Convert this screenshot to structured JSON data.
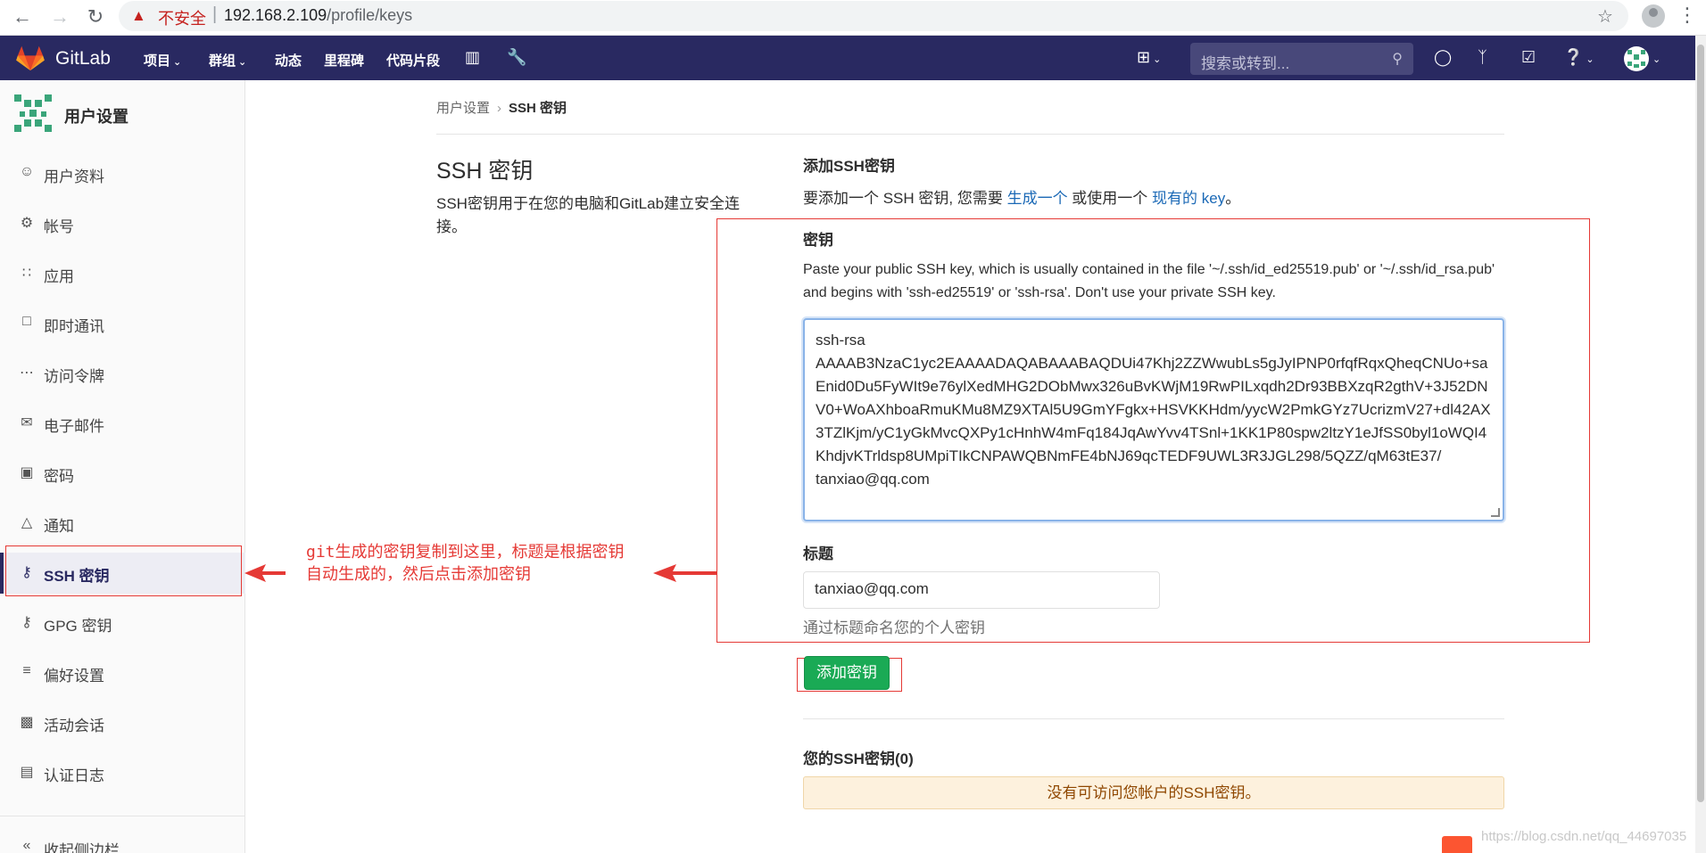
{
  "browser": {
    "insecure_label": "不安全",
    "url_host": "192.168.2.109",
    "url_path": "/profile/keys"
  },
  "header": {
    "brand": "GitLab",
    "nav": [
      {
        "label": "项目",
        "has_caret": true
      },
      {
        "label": "群组",
        "has_caret": true
      },
      {
        "label": "动态",
        "has_caret": false
      },
      {
        "label": "里程碑",
        "has_caret": false
      },
      {
        "label": "代码片段",
        "has_caret": false
      }
    ],
    "search_placeholder": "搜索或转到..."
  },
  "sidebar": {
    "title": "用户设置",
    "items": [
      {
        "label": "用户资料",
        "icon": "user-icon"
      },
      {
        "label": "帐号",
        "icon": "account-icon"
      },
      {
        "label": "应用",
        "icon": "applications-icon"
      },
      {
        "label": "即时通讯",
        "icon": "chat-icon"
      },
      {
        "label": "访问令牌",
        "icon": "token-icon"
      },
      {
        "label": "电子邮件",
        "icon": "mail-icon"
      },
      {
        "label": "密码",
        "icon": "lock-icon"
      },
      {
        "label": "通知",
        "icon": "bell-icon"
      },
      {
        "label": "SSH 密钥",
        "icon": "key-icon",
        "active": true
      },
      {
        "label": "GPG 密钥",
        "icon": "key-icon"
      },
      {
        "label": "偏好设置",
        "icon": "sliders-icon"
      },
      {
        "label": "活动会话",
        "icon": "monitor-icon"
      },
      {
        "label": "认证日志",
        "icon": "log-icon"
      }
    ],
    "collapse_label": "收起侧边栏"
  },
  "annotation": {
    "text_line1": "git生成的密钥复制到这里，标题是根据密钥",
    "text_line2": "自动生成的，然后点击添加密钥",
    "color": "#e53935"
  },
  "breadcrumb": {
    "parent": "用户设置",
    "current": "SSH 密钥"
  },
  "section": {
    "title": "SSH 密钥",
    "description": "SSH密钥用于在您的电脑和GitLab建立安全连接。"
  },
  "add_form": {
    "heading": "添加SSH密钥",
    "desc_prefix": "要添加一个 SSH 密钥, 您需要 ",
    "desc_link1": "生成一个",
    "desc_middle": " 或使用一个 ",
    "desc_link2": "现有的 key",
    "desc_suffix": "。",
    "key_label": "密钥",
    "key_help": "Paste your public SSH key, which is usually contained in the file '~/.ssh/id_ed25519.pub' or '~/.ssh/id_rsa.pub' and begins with 'ssh-ed25519' or 'ssh-rsa'. Don't use your private SSH key.",
    "key_value": "ssh-rsa\nAAAAB3NzaC1yc2EAAAADAQABAAABAQDUi47Khj2ZZWwubLs5gJyIPNP0rfqfRqxQheqCNUo+saEnid0Du5FyWIt9e76ylXedMHG2DObMwx326uBvKWjM19RwPILxqdh2Dr93BBXzqR2gthV+3J52DNV0+WoAXhboaRmuKMu8MZ9XTAl5U9GmYFgkx+HSVKKHdm/yycW2PmkGYz7UcrizmV27+dl42AX3TZlKjm/yC1yGkMvcQXPy1cHnhW4mFq184JqAwYvv4TSnl+1KK1P80spw2ltzY1eJfSS0byl1oWQI4KhdjvKTrldsp8UMpiTIkCNPAWQBNmFE4bNJ69qcTEDF9UWL3R3JGL298/5QZZ/qM63tE37/\ntanxiao@qq.com",
    "title_label": "标题",
    "title_value": "tanxiao@qq.com",
    "title_help": "通过标题命名您的个人密钥",
    "submit_label": "添加密钥"
  },
  "existing_keys": {
    "heading": "您的SSH密钥(0)",
    "empty_message": "没有可访问您帐户的SSH密钥。"
  },
  "watermark": "https://blog.csdn.net/qq_44697035",
  "colors": {
    "header_bg": "#292961",
    "submit_bg": "#1aaa55",
    "link": "#1b69b6",
    "warning_bg": "#fdf1dd"
  }
}
